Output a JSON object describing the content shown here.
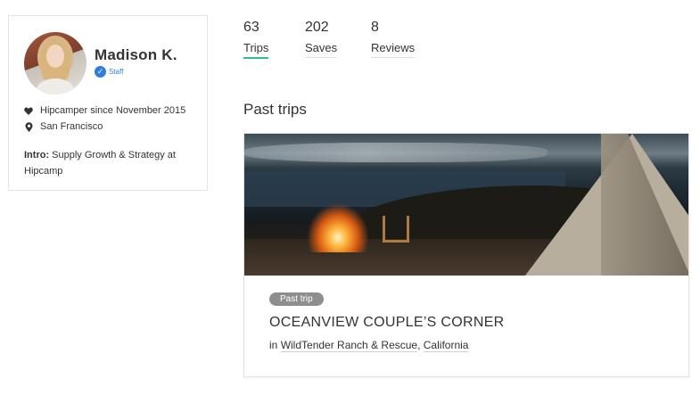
{
  "profile": {
    "name": "Madison K.",
    "staff_label": "Staff",
    "since": "Hipcamper since November 2015",
    "location": "San Francisco",
    "intro_label": "Intro:",
    "intro_text": " Supply Growth & Strategy at Hipcamp"
  },
  "stats": [
    {
      "value": "63",
      "label": "Trips",
      "active": true
    },
    {
      "value": "202",
      "label": "Saves",
      "active": false
    },
    {
      "value": "8",
      "label": "Reviews",
      "active": false
    }
  ],
  "section_title": "Past trips",
  "trip": {
    "badge": "Past trip",
    "title": "OCEANVIEW COUPLE’S CORNER",
    "location_prefix": "in ",
    "ranch": "WildTender Ranch & Rescue",
    "separator": ", ",
    "state": "California"
  },
  "colors": {
    "accent": "#2bbf95",
    "verified": "#2f7de1",
    "badge_bg": "#8e8e8e"
  },
  "icons": {
    "heart": "heart-icon",
    "pin": "location-pin-icon",
    "verified": "verified-check-icon"
  }
}
